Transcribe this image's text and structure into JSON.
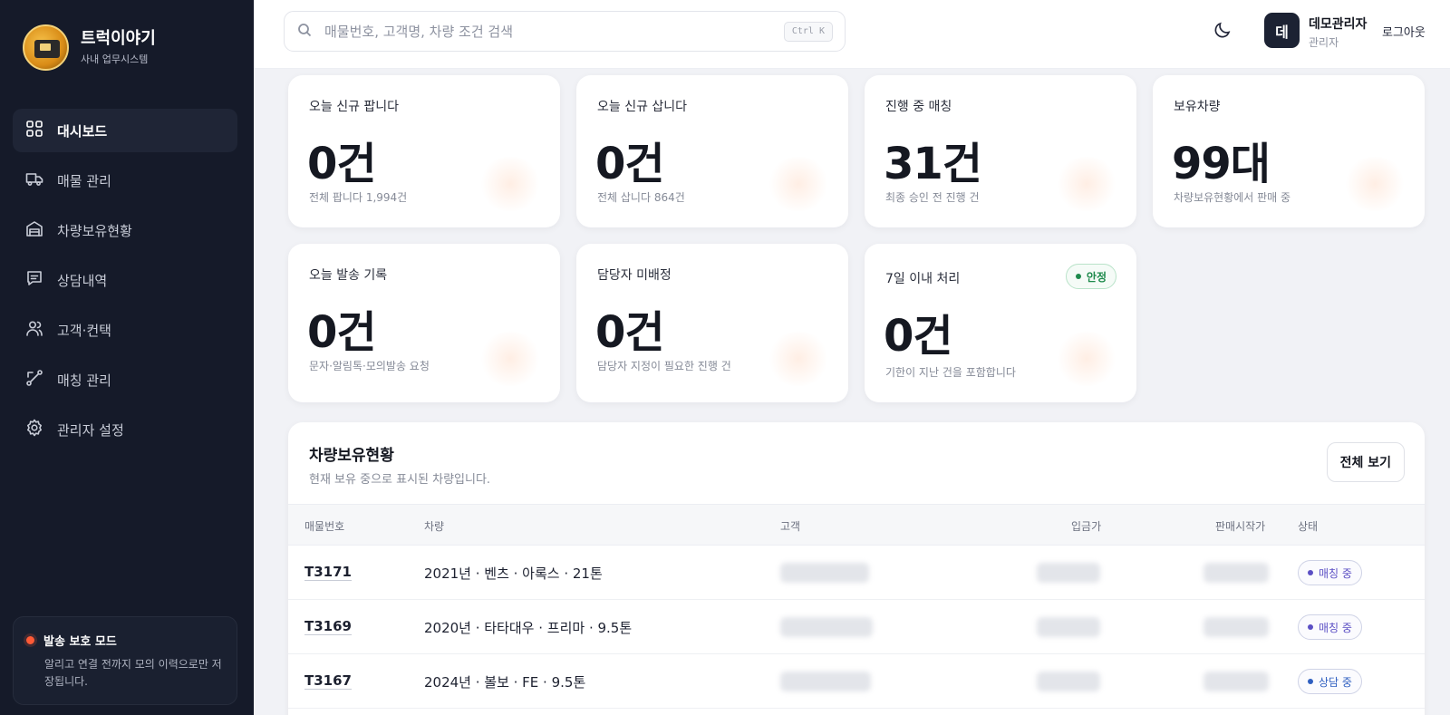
{
  "brand": {
    "name": "트럭이야기",
    "subtitle": "사내 업무시스템"
  },
  "sidebar": {
    "items": [
      {
        "label": "대시보드",
        "icon": "dashboard-grid-icon",
        "active": true
      },
      {
        "label": "매물 관리",
        "icon": "truck-icon",
        "active": false
      },
      {
        "label": "차량보유현황",
        "icon": "garage-icon",
        "active": false
      },
      {
        "label": "상담내역",
        "icon": "chat-icon",
        "active": false
      },
      {
        "label": "고객·컨택",
        "icon": "users-icon",
        "active": false
      },
      {
        "label": "매칭 관리",
        "icon": "route-icon",
        "active": false
      },
      {
        "label": "관리자 설정",
        "icon": "gear-icon",
        "active": false
      }
    ],
    "protect": {
      "title": "발송 보호 모드",
      "text": "알리고 연결 전까지 모의 이력으로만 저장됩니다."
    }
  },
  "topbar": {
    "search_placeholder": "매물번호, 고객명, 차량 조건 검색",
    "shortcut": "Ctrl K",
    "user": {
      "initial": "데",
      "name": "데모관리자",
      "role": "관리자"
    },
    "logout": "로그아웃"
  },
  "stats": [
    {
      "label": "오늘 신규 팝니다",
      "value": "0건",
      "sub": "전체 팝니다 1,994건"
    },
    {
      "label": "오늘 신규 삽니다",
      "value": "0건",
      "sub": "전체 삽니다 864건"
    },
    {
      "label": "진행 중 매칭",
      "value": "31건",
      "sub": "최종 승인 전 진행 건"
    },
    {
      "label": "보유차량",
      "value": "99대",
      "sub": "차량보유현황에서 판매 중"
    },
    {
      "label": "오늘 발송 기록",
      "value": "0건",
      "sub": "문자·알림톡·모의발송 요청"
    },
    {
      "label": "담당자 미배정",
      "value": "0건",
      "sub": "담당자 지정이 필요한 진행 건"
    },
    {
      "label": "7일 이내 처리",
      "value": "0건",
      "sub": "기한이 지난 건을 포함합니다",
      "badge": "안정"
    }
  ],
  "vehicles": {
    "title": "차량보유현황",
    "subtitle": "현재 보유 중으로 표시된 차량입니다.",
    "view_all": "전체 보기",
    "columns": [
      "매물번호",
      "차량",
      "고객",
      "입금가",
      "판매시작가",
      "상태"
    ],
    "rows": [
      {
        "id": "T3171",
        "vehicle": "2021년 · 벤츠 · 아록스 · 21톤",
        "status": "매칭 중",
        "status_color": "#5b4fc4"
      },
      {
        "id": "T3169",
        "vehicle": "2020년 · 타타대우 · 프리마 · 9.5톤",
        "status": "매칭 중",
        "status_color": "#5b4fc4"
      },
      {
        "id": "T3167",
        "vehicle": "2024년 · 볼보 · FE · 9.5톤",
        "status": "상담 중",
        "status_color": "#2f5fc0"
      }
    ]
  }
}
